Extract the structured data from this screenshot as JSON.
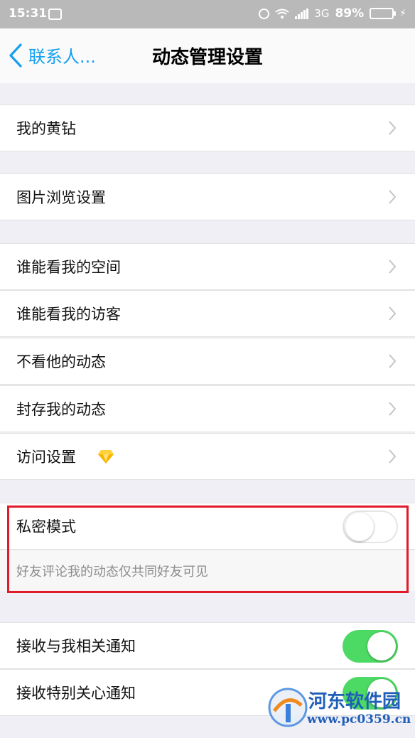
{
  "status_bar": {
    "time": "15:31",
    "network": "3G",
    "battery": "89%"
  },
  "nav": {
    "back_label": "联系人...",
    "title": "动态管理设置"
  },
  "sections": {
    "yellow_diamond": "我的黄钻",
    "photo_browse": "图片浏览设置",
    "who_see_space": "谁能看我的空间",
    "who_see_visitors": "谁能看我的访客",
    "hide_their_feeds": "不看他的动态",
    "archive_my_feeds": "封存我的动态",
    "access_settings": "访问设置",
    "private_mode": "私密模式",
    "private_mode_desc": "好友评论我的动态仅共同好友可见",
    "notify_related": "接收与我相关通知",
    "notify_special": "接收特别关心通知"
  },
  "toggles": {
    "private_mode": false,
    "notify_related": true,
    "notify_special": true
  },
  "watermark": {
    "name": "河东软件园",
    "url": "www.pc0359.cn"
  },
  "colors": {
    "accent": "#13a0f0",
    "switch_on": "#4cd964",
    "highlight": "#e01a2b"
  }
}
